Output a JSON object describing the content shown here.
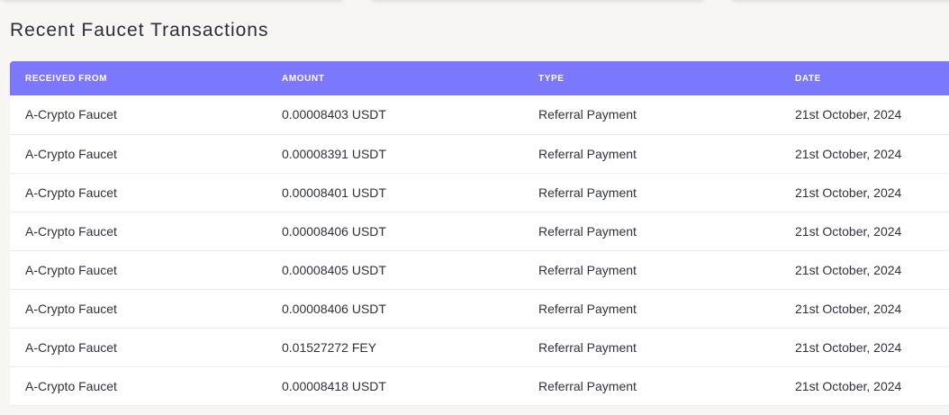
{
  "section_title": "Recent Faucet Transactions",
  "table": {
    "headers": [
      "RECEIVED FROM",
      "AMOUNT",
      "TYPE",
      "DATE"
    ],
    "rows": [
      [
        "A-Crypto Faucet",
        "0.00008403 USDT",
        "Referral Payment",
        "21st October, 2024"
      ],
      [
        "A-Crypto Faucet",
        "0.00008391 USDT",
        "Referral Payment",
        "21st October, 2024"
      ],
      [
        "A-Crypto Faucet",
        "0.00008401 USDT",
        "Referral Payment",
        "21st October, 2024"
      ],
      [
        "A-Crypto Faucet",
        "0.00008406 USDT",
        "Referral Payment",
        "21st October, 2024"
      ],
      [
        "A-Crypto Faucet",
        "0.00008405 USDT",
        "Referral Payment",
        "21st October, 2024"
      ],
      [
        "A-Crypto Faucet",
        "0.00008406 USDT",
        "Referral Payment",
        "21st October, 2024"
      ],
      [
        "A-Crypto Faucet",
        "0.01527272 FEY",
        "Referral Payment",
        "21st October, 2024"
      ],
      [
        "A-Crypto Faucet",
        "0.00008418 USDT",
        "Referral Payment",
        "21st October, 2024"
      ]
    ]
  },
  "colors": {
    "header_bg": "#7b78fd",
    "page_bg": "#f7f6f2"
  }
}
